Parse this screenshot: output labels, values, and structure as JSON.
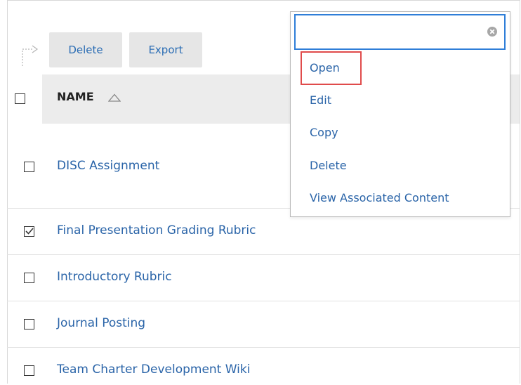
{
  "toolbar": {
    "delete_label": "Delete",
    "export_label": "Export"
  },
  "table": {
    "header": {
      "name_label": "NAME",
      "sort_direction": "ascending"
    },
    "rows": [
      {
        "label": "DISC Assignment",
        "checked": false
      },
      {
        "label": "Final Presentation Grading Rubric",
        "checked": true
      },
      {
        "label": "Introductory Rubric",
        "checked": false
      },
      {
        "label": "Journal Posting",
        "checked": false
      },
      {
        "label": "Team Charter Development Wiki",
        "checked": false
      }
    ]
  },
  "context_menu": {
    "search_value": "",
    "items": [
      {
        "label": "Open",
        "highlighted": true
      },
      {
        "label": "Edit"
      },
      {
        "label": "Copy"
      },
      {
        "label": "Delete"
      },
      {
        "label": "View Associated Content"
      }
    ]
  },
  "colors": {
    "link": "#2a64a8",
    "search_focus": "#2f7ed8",
    "highlight_box": "#e04b4b",
    "header_bg": "#ececec",
    "button_bg": "#e6e6e6"
  }
}
